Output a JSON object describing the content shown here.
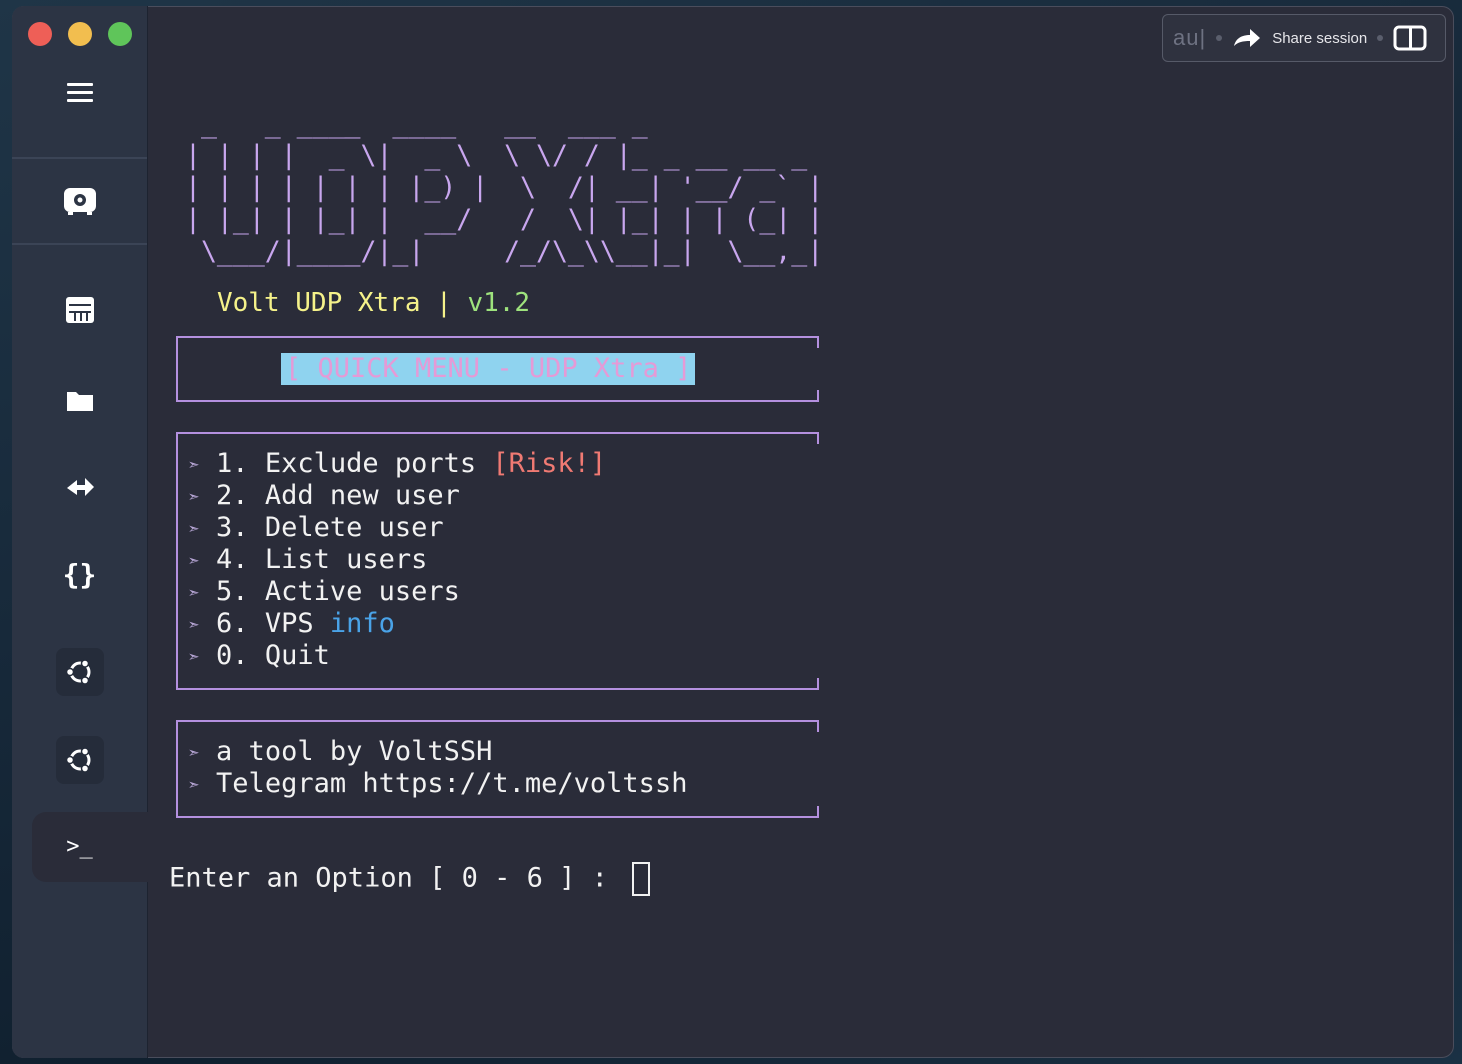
{
  "window": {
    "traffic_lights": [
      "close",
      "minimize",
      "zoom"
    ]
  },
  "sidebar": {
    "items": [
      {
        "icon": "menu-icon"
      },
      {
        "icon": "vault-icon"
      },
      {
        "icon": "hosts-icon"
      },
      {
        "icon": "sftp-folder-icon"
      },
      {
        "icon": "port-forwarding-icon"
      },
      {
        "icon": "snippets-icon"
      },
      {
        "icon": "ubuntu-host-icon"
      },
      {
        "icon": "ubuntu-host-icon"
      },
      {
        "icon": "terminal-icon",
        "active": true
      }
    ]
  },
  "topbar": {
    "typed_text": "au|",
    "share_label": "Share session",
    "share_icon": "share-arrow-icon",
    "split_icon": "split-view-icon"
  },
  "terminal": {
    "banner_ascii": " _   _ ____  ____   __  ___ _                \n| | | |  _ \\|  _ \\  \\ \\/ / |_ _ __ __ _   \n| | | | | | | |_) |  \\  /| __| '__/ _` |  \n| |_| | |_| |  __/   /  \\| |_| | | (_| |  \n \\___/|____/|_|     /_/\\_\\\\__|_|  \\__,_|  ",
    "subtitle_main": "Volt UDP Xtra | ",
    "subtitle_version": "v1.2",
    "quick_menu": "[ QUICK MENU - UDP Xtra ]",
    "arrow": "➣",
    "menu": [
      {
        "text": "1. Exclude ports ",
        "extra": "[Risk!]"
      },
      {
        "text": "2. Add new user"
      },
      {
        "text": "3. Delete user"
      },
      {
        "text": "4. List users"
      },
      {
        "text": "5. Active users"
      },
      {
        "text": "6. VPS ",
        "extra": "info"
      },
      {
        "text": "0. Quit"
      }
    ],
    "credits": [
      "a tool by VoltSSH",
      "Telegram https://t.me/voltssh"
    ],
    "prompt": "Enter an Option [ 0 - 6 ] : "
  },
  "colors": {
    "banner": "#c8a6ee",
    "subtitle": "#f5f28a",
    "version": "#9ee37d",
    "box_border": "#b490df",
    "quick_menu_bg": "#8fd3ef",
    "quick_menu_fg": "#e59ad6",
    "risk": "#f07a73",
    "info": "#4aa3e8"
  }
}
